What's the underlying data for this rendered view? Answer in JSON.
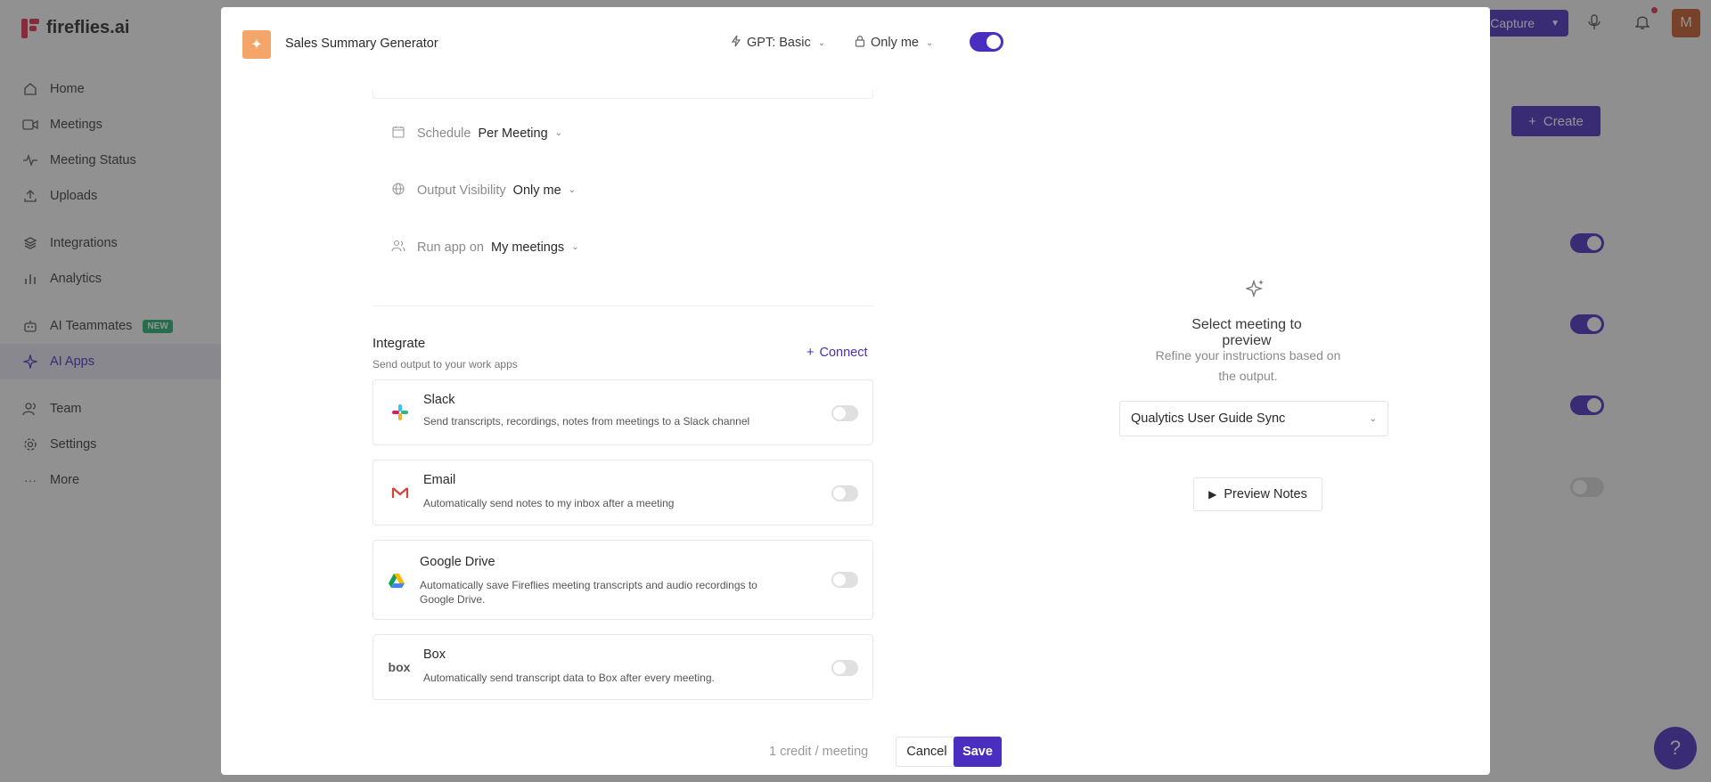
{
  "app": {
    "brand": "fireflies.ai",
    "top": {
      "capture_label": "Capture",
      "avatar_initial": "M"
    },
    "create_label": "Create"
  },
  "sidebar": {
    "items": [
      {
        "label": "Home",
        "icon": "home-icon"
      },
      {
        "label": "Meetings",
        "icon": "video-icon"
      },
      {
        "label": "Meeting Status",
        "icon": "activity-icon"
      },
      {
        "label": "Uploads",
        "icon": "upload-icon"
      },
      {
        "label": "Integrations",
        "icon": "layers-icon"
      },
      {
        "label": "Analytics",
        "icon": "bar-chart-icon"
      },
      {
        "label": "AI Teammates",
        "icon": "robot-icon",
        "badge": "NEW"
      },
      {
        "label": "AI Apps",
        "icon": "sparkle-icon"
      },
      {
        "label": "Team",
        "icon": "team-icon"
      },
      {
        "label": "Settings",
        "icon": "gear-icon"
      },
      {
        "label": "More",
        "icon": "more-icon"
      }
    ]
  },
  "modal": {
    "app_name": "Sales Summary Generator",
    "model": "GPT: Basic",
    "visibility": "Only me",
    "settings": {
      "schedule_label": "Schedule",
      "schedule_value": "Per Meeting",
      "output_label": "Output Visibility",
      "output_value": "Only me",
      "run_label": "Run app on",
      "run_value": "My meetings"
    },
    "integrate": {
      "title": "Integrate",
      "subtitle": "Send output to your work apps",
      "connect_label": "Connect",
      "cards": [
        {
          "title": "Slack",
          "desc": "Send transcripts, recordings, notes from meetings to a Slack channel",
          "icon": "slack-icon"
        },
        {
          "title": "Email",
          "desc": "Automatically send notes to my inbox after a meeting",
          "icon": "gmail-icon"
        },
        {
          "title": "Google Drive",
          "desc": "Automatically save Fireflies meeting transcripts and audio recordings to Google Drive.",
          "icon": "google-drive-icon"
        },
        {
          "title": "Box",
          "desc": "Automatically send transcript data to Box after every meeting.",
          "icon": "box-icon"
        }
      ]
    },
    "footer": {
      "credit": "1 credit / meeting",
      "cancel": "Cancel",
      "save": "Save"
    },
    "preview": {
      "title": "Select meeting to preview",
      "subtitle": "Refine your instructions based on the output.",
      "selected_meeting": "Qualytics User Guide Sync",
      "button": "Preview Notes"
    }
  },
  "colors": {
    "accent": "#4a2ec0",
    "brand": "#e0314f"
  }
}
